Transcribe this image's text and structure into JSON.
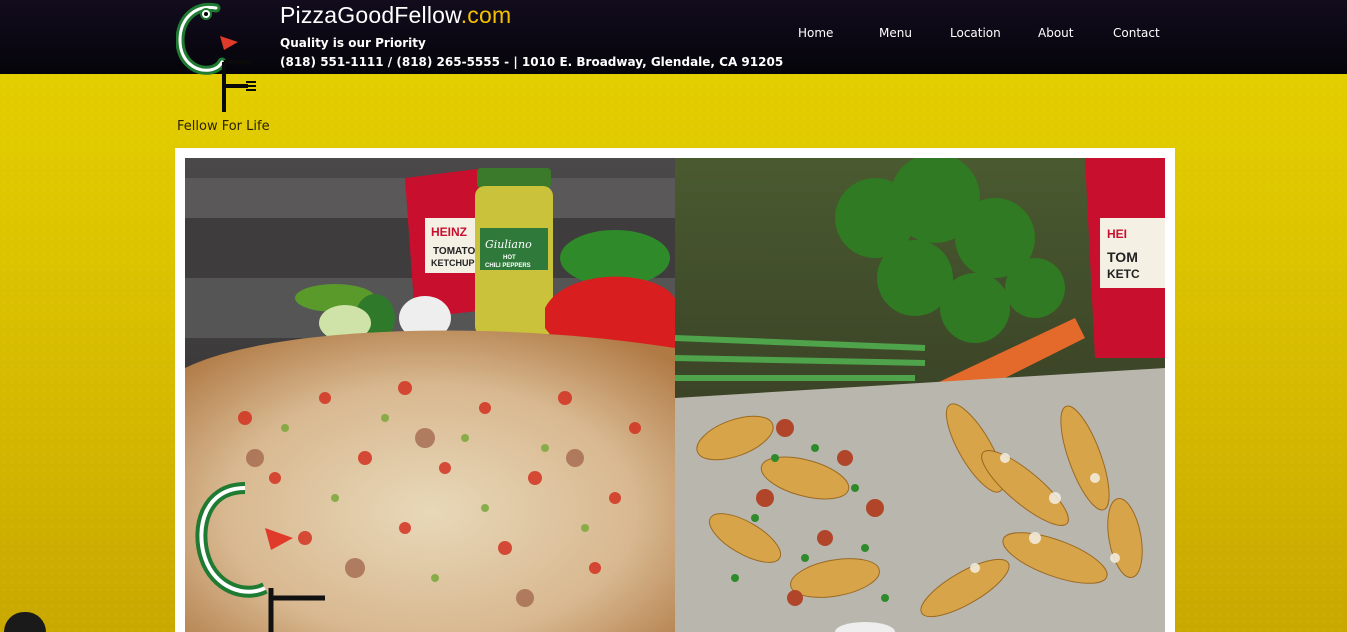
{
  "header": {
    "brand_name": "PizzaGoodFellow",
    "brand_tld": ".com",
    "tagline": "Quality is our Priority",
    "contact": "(818) 551-1111  /  (818) 265-5555 - | 1010 E. Broadway, Glendale, CA 91205",
    "logo_icon": "gf-fork-logo-icon"
  },
  "nav": {
    "items": [
      {
        "label": "Home"
      },
      {
        "label": "Menu"
      },
      {
        "label": "Location"
      },
      {
        "label": "About"
      },
      {
        "label": "Contact"
      }
    ]
  },
  "slogan": "Fellow For Life",
  "gallery": {
    "left_photo": "pizza-photo",
    "right_photo": "fries-photo",
    "left_photo_brands": {
      "ketchup_brand": "HEINZ",
      "ketchup_word1": "TOMATO",
      "ketchup_word2": "KETCHUP",
      "jar_brand": "Giuliano",
      "jar_badge": "HOT",
      "jar_label": "CHILI PEPPERS"
    },
    "right_photo_brands": {
      "ketchup_brand": "HEI",
      "ketchup_word1": "TOM",
      "ketchup_word2": "KETC"
    }
  },
  "colors": {
    "header_bg": "#0b0712",
    "accent": "#f4c000",
    "page_bg": "#dcc400"
  }
}
